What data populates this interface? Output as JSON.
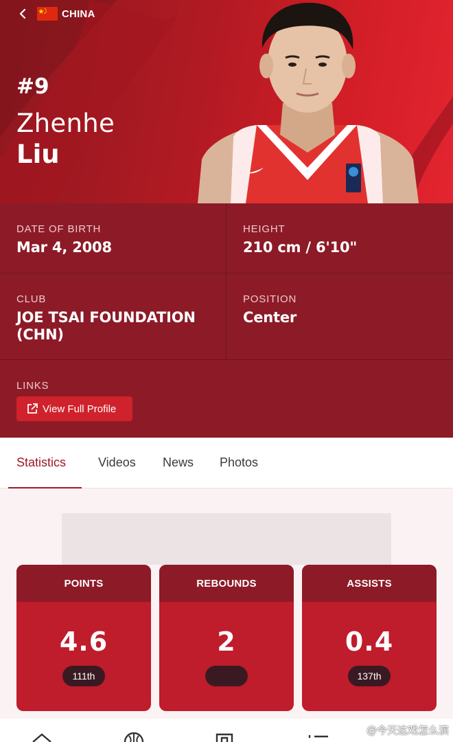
{
  "header": {
    "country": "CHINA",
    "jersey_number": "#9",
    "first_name": "Zhenhe",
    "last_name": "Liu"
  },
  "info": {
    "dob_label": "DATE OF BIRTH",
    "dob_value": "Mar 4, 2008",
    "height_label": "HEIGHT",
    "height_value": "210 cm / 6'10\"",
    "club_label": "CLUB",
    "club_value_line1": "JOE TSAI FOUNDATION",
    "club_value_line2": "(CHN)",
    "position_label": "POSITION",
    "position_value": "Center",
    "links_label": "LINKS",
    "profile_button": "View Full Profile"
  },
  "tabs": [
    {
      "label": "Statistics",
      "active": true
    },
    {
      "label": "Videos",
      "active": false
    },
    {
      "label": "News",
      "active": false
    },
    {
      "label": "Photos",
      "active": false
    }
  ],
  "stats": [
    {
      "label": "POINTS",
      "value": "4.6",
      "rank": "111th"
    },
    {
      "label": "REBOUNDS",
      "value": "2",
      "rank": ""
    },
    {
      "label": "ASSISTS",
      "value": "0.4",
      "rank": "137th"
    }
  ],
  "bottom_nav": [
    {
      "icon": "home-icon"
    },
    {
      "icon": "basketball-icon"
    },
    {
      "icon": "bracket-icon"
    },
    {
      "icon": "list-icon"
    }
  ],
  "watermark": "@今天这戏怎么演",
  "colors": {
    "brand_red": "#bf1c2c",
    "dark_red": "#8c1b27",
    "active_tab": "#a11826"
  }
}
